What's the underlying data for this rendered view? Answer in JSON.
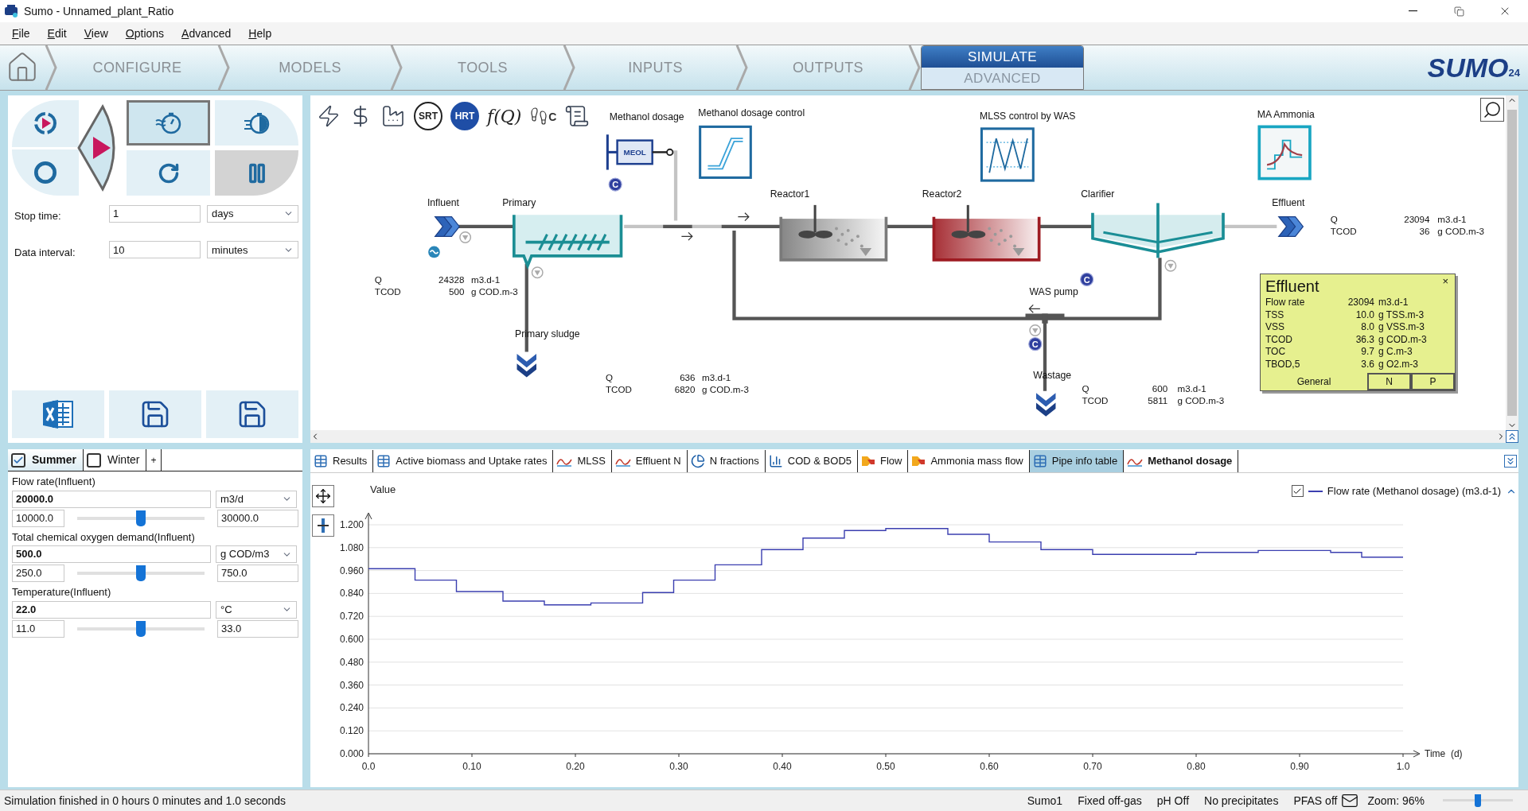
{
  "window": {
    "title": "Sumo - Unnamed_plant_Ratio"
  },
  "menu": [
    "File",
    "Edit",
    "View",
    "Options",
    "Advanced",
    "Help"
  ],
  "nav": [
    {
      "label": "CONFIGURE",
      "selected": false
    },
    {
      "label": "MODELS",
      "selected": false
    },
    {
      "label": "TOOLS",
      "selected": false
    },
    {
      "label": "INPUTS",
      "selected": false
    },
    {
      "label": "OUTPUTS",
      "selected": false
    }
  ],
  "simulate_tabs": [
    {
      "label": "SIMULATE",
      "selected": true
    },
    {
      "label": "ADVANCED",
      "selected": false
    }
  ],
  "logo": {
    "text": "SUMO",
    "badge": "24"
  },
  "sim_modes": [
    {
      "kind": "dynamic",
      "selected": true
    },
    {
      "kind": "fast",
      "selected": false
    }
  ],
  "pause": {
    "disabled": true
  },
  "stop_time": {
    "label": "Stop time:",
    "value": "1",
    "unit": "days"
  },
  "data_interval": {
    "label": "Data interval:",
    "value": "10",
    "unit": "minutes"
  },
  "scenarios": [
    {
      "label": "Summer",
      "checked": true,
      "selected": true
    },
    {
      "label": "Winter",
      "checked": false,
      "selected": false
    }
  ],
  "add_scenario": "+",
  "parameters": [
    {
      "label": "Flow rate(Influent)",
      "value": "20000.0",
      "unit": "m3/d",
      "min": "10000.0",
      "max": "30000.0",
      "level": 0.5
    },
    {
      "label": "Total chemical oxygen demand(Influent)",
      "value": "500.0",
      "unit": "g COD/m3",
      "min": "250.0",
      "max": "750.0",
      "level": 0.5
    },
    {
      "label": "Temperature(Influent)",
      "value": "22.0",
      "unit": "°C",
      "min": "11.0",
      "max": "33.0",
      "level": 0.5
    }
  ],
  "toolbar": [
    {
      "kind": "energy"
    },
    {
      "kind": "cost"
    },
    {
      "kind": "emissions"
    },
    {
      "kind": "badge",
      "label": "SRT",
      "filled": false
    },
    {
      "kind": "badge",
      "label": "HRT",
      "filled": true
    },
    {
      "kind": "function",
      "label": "f(Q)"
    },
    {
      "kind": "footprint",
      "label": "C"
    },
    {
      "kind": "scroll"
    }
  ],
  "flowsheet": {
    "nodes": [
      {
        "kind": "dosage",
        "label": "Methanol dosage",
        "tag": "MEOL"
      },
      {
        "kind": "ramp-control",
        "label": "Methanol dosage control"
      },
      {
        "kind": "wave-control",
        "label": "MLSS control by WAS"
      },
      {
        "kind": "curve-control",
        "label": "MA Ammonia"
      },
      {
        "kind": "influent",
        "label": "Influent"
      },
      {
        "kind": "primary",
        "label": "Primary"
      },
      {
        "kind": "sludge",
        "label": "Primary sludge"
      },
      {
        "kind": "reactor",
        "label": "Reactor1",
        "color": "#7a7a7a"
      },
      {
        "kind": "reactor",
        "label": "Reactor2",
        "color": "#9e1b22"
      },
      {
        "kind": "clarifier",
        "label": "Clarifier"
      },
      {
        "kind": "effluent",
        "label": "Effluent"
      },
      {
        "kind": "pump",
        "label": "WAS pump"
      },
      {
        "kind": "sludge",
        "label": "Wastage"
      }
    ],
    "controller_badges": [
      "C",
      "C",
      "C"
    ],
    "stream_tables": [
      {
        "rows": [
          {
            "name": "Q",
            "value": "24328",
            "unit": "m3.d-1"
          },
          {
            "name": "TCOD",
            "value": "500",
            "unit": "g COD.m-3"
          }
        ]
      },
      {
        "rows": [
          {
            "name": "Q",
            "value": "636",
            "unit": "m3.d-1"
          },
          {
            "name": "TCOD",
            "value": "6820",
            "unit": "g COD.m-3"
          }
        ]
      },
      {
        "rows": [
          {
            "name": "Q",
            "value": "600",
            "unit": "m3.d-1"
          },
          {
            "name": "TCOD",
            "value": "5811",
            "unit": "g COD.m-3"
          }
        ]
      },
      {
        "rows": [
          {
            "name": "Q",
            "value": "23094",
            "unit": "m3.d-1"
          },
          {
            "name": "TCOD",
            "value": "36",
            "unit": "g COD.m-3"
          }
        ]
      }
    ],
    "popup": {
      "title": "Effluent",
      "close": "×",
      "rows": [
        {
          "name": "Flow rate",
          "value": "23094",
          "unit": "m3.d-1"
        },
        {
          "name": "TSS",
          "value": "10.0",
          "unit": "g TSS.m-3"
        },
        {
          "name": "VSS",
          "value": "8.0",
          "unit": "g VSS.m-3"
        },
        {
          "name": "TCOD",
          "value": "36.3",
          "unit": "g COD.m-3"
        },
        {
          "name": "TOC",
          "value": "9.7",
          "unit": "g C.m-3"
        },
        {
          "name": "TBOD,5",
          "value": "3.6",
          "unit": "g O2.m-3"
        }
      ],
      "tabs": [
        {
          "label": "General",
          "selected": true
        },
        {
          "label": "N",
          "selected": false
        },
        {
          "label": "P",
          "selected": false
        }
      ]
    }
  },
  "output_tabs": [
    {
      "label": "Results",
      "kind": "table",
      "selected": false,
      "highlighted": false
    },
    {
      "label": "Active biomass and Uptake rates",
      "kind": "table",
      "selected": false,
      "highlighted": false
    },
    {
      "label": "MLSS",
      "kind": "line",
      "selected": false,
      "highlighted": false
    },
    {
      "label": "Effluent N",
      "kind": "line",
      "selected": false,
      "highlighted": false
    },
    {
      "label": "N fractions",
      "kind": "pie",
      "selected": false,
      "highlighted": false
    },
    {
      "label": "COD & BOD5",
      "kind": "bar",
      "selected": false,
      "highlighted": false
    },
    {
      "label": "Flow",
      "kind": "flow",
      "selected": false,
      "highlighted": false
    },
    {
      "label": "Ammonia mass flow",
      "kind": "flow",
      "selected": false,
      "highlighted": false
    },
    {
      "label": "Pipe info table",
      "kind": "table",
      "selected": false,
      "highlighted": true
    },
    {
      "label": "Methanol dosage",
      "kind": "line",
      "selected": true,
      "highlighted": false
    }
  ],
  "chart": {
    "legend_checked": true,
    "chart_data": {
      "type": "line",
      "ylabel": "Value",
      "xlabel": "Time  (d)",
      "x": [
        0,
        0.045,
        0.045,
        0.085,
        0.085,
        0.13,
        0.13,
        0.17,
        0.17,
        0.215,
        0.215,
        0.265,
        0.265,
        0.295,
        0.295,
        0.335,
        0.335,
        0.38,
        0.38,
        0.42,
        0.42,
        0.46,
        0.46,
        0.5,
        0.5,
        0.56,
        0.56,
        0.6,
        0.6,
        0.65,
        0.65,
        0.7,
        0.7,
        0.8,
        0.8,
        0.86,
        0.86,
        0.93,
        0.93,
        0.96,
        0.96,
        1.0
      ],
      "series": [
        {
          "name": "Flow rate (Methanol dosage) (m3.d-1)",
          "color": "#3b3fb0",
          "values": [
            0.97,
            0.97,
            0.91,
            0.91,
            0.85,
            0.85,
            0.8,
            0.8,
            0.78,
            0.78,
            0.79,
            0.79,
            0.845,
            0.845,
            0.91,
            0.91,
            0.99,
            0.99,
            1.07,
            1.07,
            1.13,
            1.13,
            1.17,
            1.17,
            1.18,
            1.18,
            1.15,
            1.15,
            1.11,
            1.11,
            1.07,
            1.07,
            1.045,
            1.045,
            1.055,
            1.055,
            1.065,
            1.065,
            1.055,
            1.055,
            1.03,
            1.03
          ]
        }
      ],
      "grid": true,
      "xlim": [
        0,
        1
      ],
      "ylim": [
        0,
        1.2
      ],
      "xticks": [
        {
          "value": 0,
          "label": "0.0"
        },
        {
          "value": 0.1,
          "label": "0.10"
        },
        {
          "value": 0.2,
          "label": "0.20"
        },
        {
          "value": 0.3,
          "label": "0.30"
        },
        {
          "value": 0.4,
          "label": "0.40"
        },
        {
          "value": 0.5,
          "label": "0.50"
        },
        {
          "value": 0.6,
          "label": "0.60"
        },
        {
          "value": 0.7,
          "label": "0.70"
        },
        {
          "value": 0.8,
          "label": "0.80"
        },
        {
          "value": 0.9,
          "label": "0.90"
        },
        {
          "value": 1,
          "label": "1.0"
        }
      ],
      "yticks": [
        {
          "value": 0,
          "label": "0.000"
        },
        {
          "value": 0.12,
          "label": "0.120"
        },
        {
          "value": 0.24,
          "label": "0.240"
        },
        {
          "value": 0.36,
          "label": "0.360"
        },
        {
          "value": 0.48,
          "label": "0.480"
        },
        {
          "value": 0.6,
          "label": "0.600"
        },
        {
          "value": 0.72,
          "label": "0.720"
        },
        {
          "value": 0.84,
          "label": "0.840"
        },
        {
          "value": 0.96,
          "label": "0.960"
        },
        {
          "value": 1.08,
          "label": "1.080"
        },
        {
          "value": 1.2,
          "label": "1.200"
        }
      ]
    }
  },
  "status_bar": {
    "message": "Simulation finished in 0 hours 0 minutes and 1.0 seconds",
    "items": [
      "Sumo1",
      "Fixed off-gas",
      "pH Off",
      "No precipitates",
      "PFAS off"
    ],
    "zoom": "Zoom: 96%",
    "zoom_slider": {
      "level": 0.5
    }
  }
}
